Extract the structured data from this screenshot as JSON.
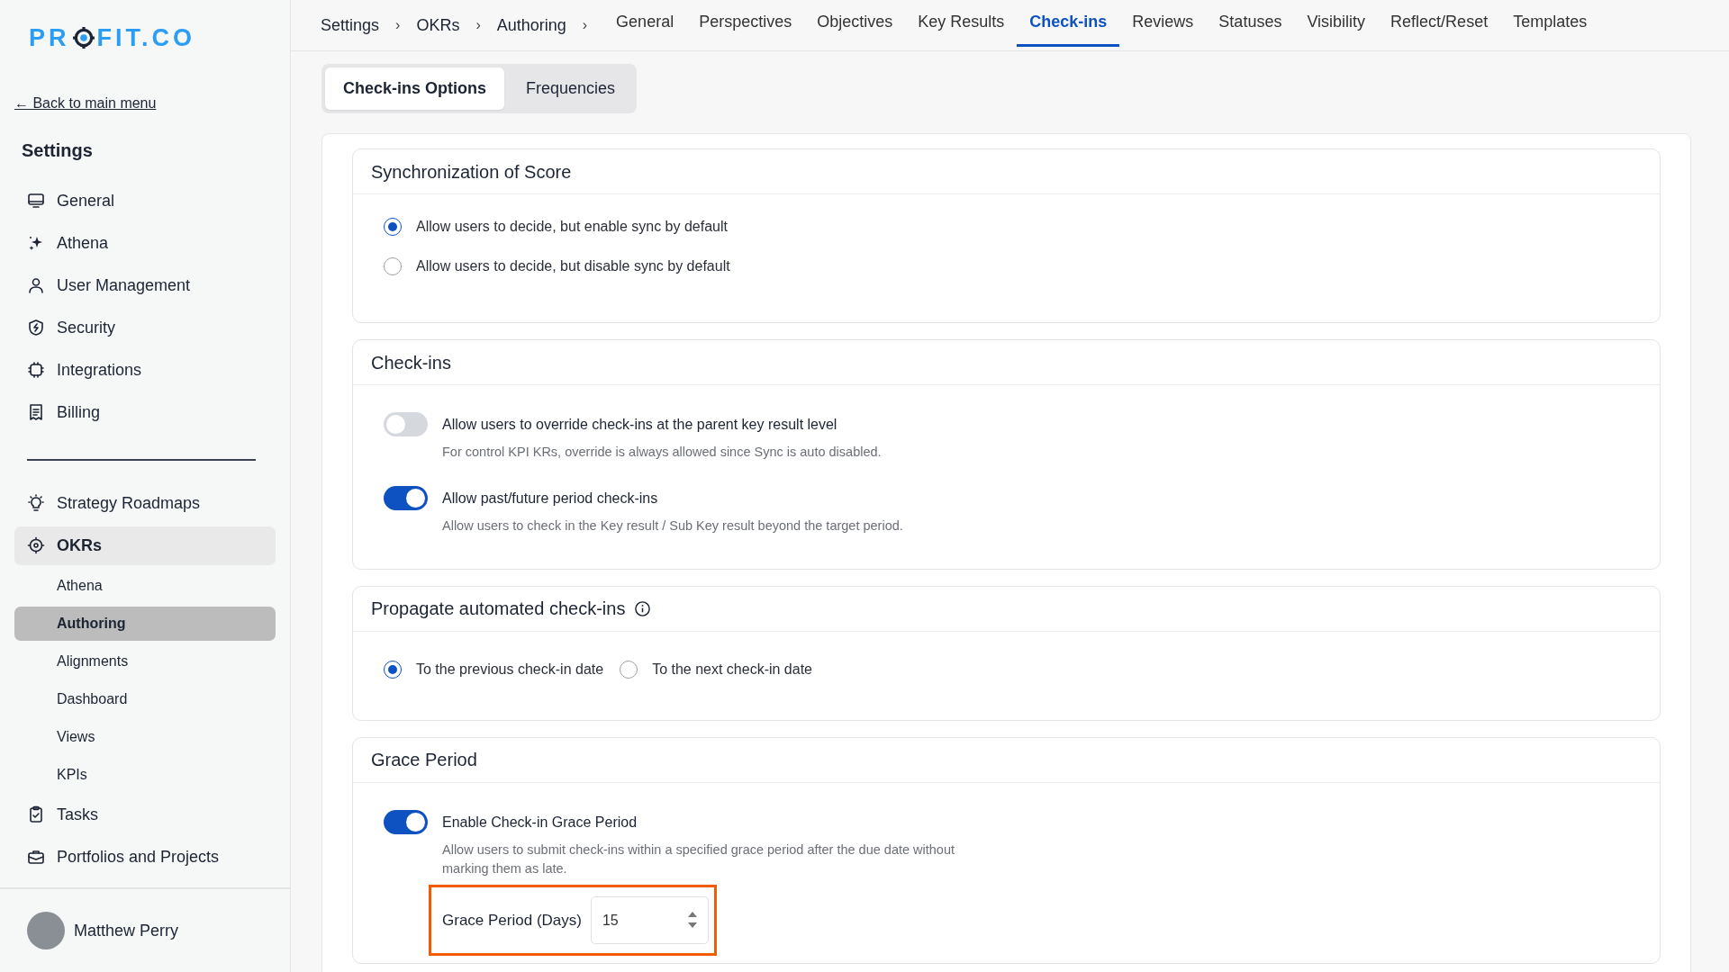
{
  "logo": {
    "text_before": "PR",
    "text_after": "FIT.CO"
  },
  "sidebar": {
    "back_link": "← Back to main menu",
    "title": "Settings",
    "sections": [
      {
        "items": [
          {
            "label": "General",
            "selected": false
          },
          {
            "label": "Athena",
            "selected": false
          },
          {
            "label": "User Management",
            "selected": false
          },
          {
            "label": "Security",
            "selected": false
          },
          {
            "label": "Integrations",
            "selected": false
          },
          {
            "label": "Billing",
            "selected": false
          }
        ]
      },
      {
        "items": [
          {
            "label": "Strategy Roadmaps",
            "selected": false
          },
          {
            "label": "OKRs",
            "selected": true,
            "children": [
              {
                "label": "Athena",
                "selected": false
              },
              {
                "label": "Authoring",
                "selected": true
              },
              {
                "label": "Alignments",
                "selected": false
              },
              {
                "label": "Dashboard",
                "selected": false
              },
              {
                "label": "Views",
                "selected": false
              },
              {
                "label": "KPIs",
                "selected": false
              }
            ]
          },
          {
            "label": "Tasks",
            "selected": false
          },
          {
            "label": "Portfolios and Projects",
            "selected": false
          }
        ]
      }
    ],
    "user": {
      "name": "Matthew Perry"
    }
  },
  "breadcrumb": [
    {
      "label": "Settings",
      "separator": "›"
    },
    {
      "label": "OKRs",
      "separator": "›"
    },
    {
      "label": "Authoring",
      "separator": "›"
    }
  ],
  "tabs": [
    {
      "label": "General",
      "selected": false
    },
    {
      "label": "Perspectives",
      "selected": false
    },
    {
      "label": "Objectives",
      "selected": false
    },
    {
      "label": "Key Results",
      "selected": false
    },
    {
      "label": "Check-ins",
      "selected": true
    },
    {
      "label": "Reviews",
      "selected": false
    },
    {
      "label": "Statuses",
      "selected": false
    },
    {
      "label": "Visibility",
      "selected": false
    },
    {
      "label": "Reflect/Reset",
      "selected": false
    },
    {
      "label": "Templates",
      "selected": false
    }
  ],
  "subtabs": [
    {
      "label": "Check-ins Options",
      "selected": true
    },
    {
      "label": "Frequencies",
      "selected": false
    }
  ],
  "sections": [
    {
      "kind": "radios",
      "title": "Synchronization of Score",
      "info": false,
      "options": [
        {
          "label": "Allow users to decide, but enable sync by default",
          "selected": true
        },
        {
          "label": "Allow users to decide, but disable sync by default",
          "selected": false
        }
      ]
    },
    {
      "kind": "toggles",
      "title": "Check-ins",
      "info": false,
      "toggles": [
        {
          "label": "Allow users to override check-ins at the parent key result level",
          "description": "For control KPI KRs, override is always allowed since Sync is auto disabled.",
          "on": false
        },
        {
          "label": "Allow past/future period check-ins",
          "description": "Allow users to check in the Key result / Sub Key result beyond the target period.",
          "on": true
        }
      ]
    },
    {
      "kind": "radios_inline",
      "title": "Propagate automated check-ins",
      "info": true,
      "options": [
        {
          "label": "To the previous check-in date",
          "selected": true
        },
        {
          "label": "To the next check-in date",
          "selected": false
        }
      ]
    },
    {
      "kind": "toggles",
      "title": "Grace Period",
      "info": false,
      "toggles": [
        {
          "label": "Enable Check-in Grace Period",
          "description": "Allow users to submit check-ins within a specified grace period after the due date without marking them as late.",
          "on": true,
          "field": {
            "label": "Grace Period (Days)",
            "value": "15",
            "highlighted": true
          }
        }
      ]
    }
  ]
}
